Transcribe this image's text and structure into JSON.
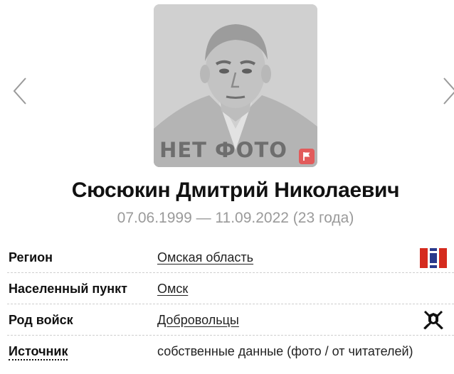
{
  "photo": {
    "placeholder_text": "НЕТ ФОТО",
    "flag_icon": "flag-icon",
    "badge_color": "#e25b5b"
  },
  "navigation": {
    "prev_icon": "chevron-left-icon",
    "next_icon": "chevron-right-icon"
  },
  "person": {
    "name": "Сюсюкин Дмитрий Николаевич",
    "dates": "07.06.1999 — 11.09.2022 (23 года)"
  },
  "details": [
    {
      "label": "Регион",
      "value": "Омская область",
      "icon": "region-flag-icon"
    },
    {
      "label": "Населенный пункт",
      "value": "Омск"
    },
    {
      "label": "Род войск",
      "value": "Добровольцы",
      "icon": "crossed-swords-emblem-icon"
    },
    {
      "label": "Источник",
      "value": "собственные данные (фото / от читателей)"
    }
  ]
}
